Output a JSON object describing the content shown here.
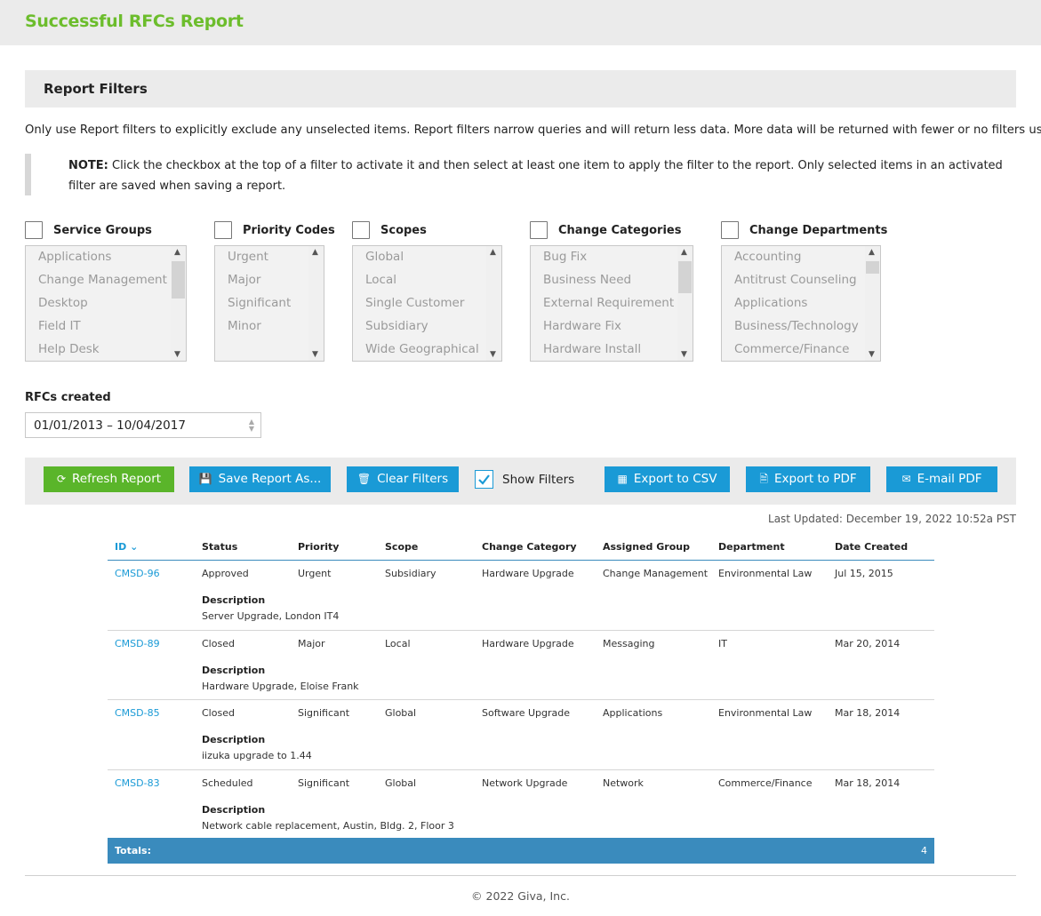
{
  "header": {
    "title": "Successful RFCs Report"
  },
  "filters": {
    "title": "Report Filters",
    "intro": "Only use Report filters to explicitly exclude any unselected items. Report filters narrow queries and will return less data. More data will be returned with fewer or no filters used.",
    "note_label": "NOTE:",
    "note_text": " Click the checkbox at the top of a filter to activate it and then select at least one item to apply the filter to the report. Only selected items in an activated filter are saved when saving a report.",
    "service_groups": {
      "label": "Service Groups",
      "items": [
        "Applications",
        "Change Management",
        "Desktop",
        "Field IT",
        "Help Desk"
      ]
    },
    "priority_codes": {
      "label": "Priority Codes",
      "items": [
        "Urgent",
        "Major",
        "Significant",
        "Minor"
      ]
    },
    "scopes": {
      "label": "Scopes",
      "items": [
        "Global",
        "Local",
        "Single Customer",
        "Subsidiary",
        "Wide Geographical"
      ]
    },
    "change_categories": {
      "label": "Change Categories",
      "items": [
        "Bug Fix",
        "Business Need",
        "External Requirement",
        "Hardware Fix",
        "Hardware Install"
      ]
    },
    "change_departments": {
      "label": "Change Departments",
      "items": [
        "Accounting",
        "Antitrust Counseling",
        "Applications",
        "Business/Technology",
        "Commerce/Finance"
      ]
    }
  },
  "rfcs_created": {
    "label": "RFCs created",
    "value": "01/01/2013 – 10/04/2017"
  },
  "toolbar": {
    "refresh": "Refresh Report",
    "save": "Save Report As...",
    "clear": "Clear Filters",
    "show_filters": "Show Filters",
    "show_filters_checked": true,
    "export_csv": "Export to CSV",
    "export_pdf": "Export to PDF",
    "email_pdf": "E-mail PDF"
  },
  "last_updated": "Last Updated: December 19, 2022 10:52a PST",
  "table": {
    "columns": [
      "ID",
      "Status",
      "Priority",
      "Scope",
      "Change Category",
      "Assigned Group",
      "Department",
      "Date Created"
    ],
    "description_label": "Description",
    "rows": [
      {
        "id": "CMSD-96",
        "status": "Approved",
        "priority": "Urgent",
        "scope": "Subsidiary",
        "category": "Hardware Upgrade",
        "group": "Change Management",
        "department": "Environmental Law",
        "date": "Jul 15, 2015",
        "description": "Server Upgrade, London IT4"
      },
      {
        "id": "CMSD-89",
        "status": "Closed",
        "priority": "Major",
        "scope": "Local",
        "category": "Hardware Upgrade",
        "group": "Messaging",
        "department": "IT",
        "date": "Mar 20, 2014",
        "description": "Hardware Upgrade, Eloise Frank"
      },
      {
        "id": "CMSD-85",
        "status": "Closed",
        "priority": "Significant",
        "scope": "Global",
        "category": "Software Upgrade",
        "group": "Applications",
        "department": "Environmental Law",
        "date": "Mar 18, 2014",
        "description": "iizuka upgrade to 1.44"
      },
      {
        "id": "CMSD-83",
        "status": "Scheduled",
        "priority": "Significant",
        "scope": "Global",
        "category": "Network Upgrade",
        "group": "Network",
        "department": "Commerce/Finance",
        "date": "Mar 18, 2014",
        "description": "Network cable replacement, Austin, Bldg. 2, Floor 3"
      }
    ],
    "totals_label": "Totals:",
    "totals_value": "4"
  },
  "footer": "© 2022 Giva, Inc.",
  "colors": {
    "brand_green": "#6cbd2c",
    "button_blue": "#1a9ad6",
    "button_green": "#5ab52a",
    "totals_blue": "#3a8bbd"
  }
}
